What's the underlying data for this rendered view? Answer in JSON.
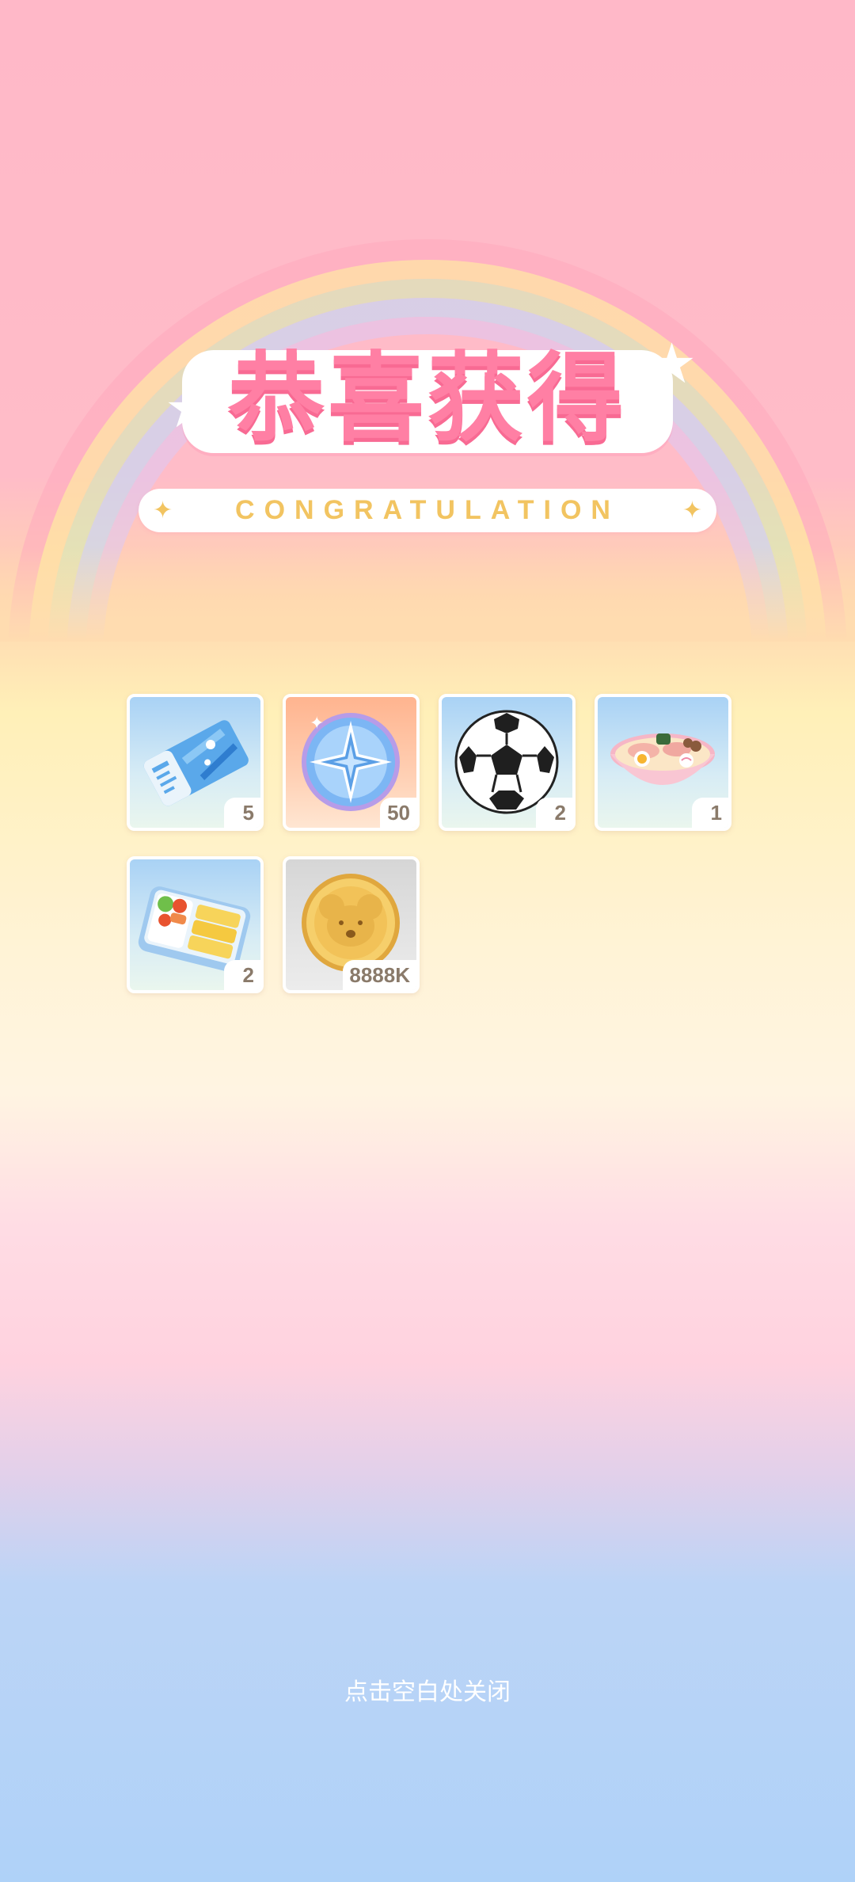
{
  "header": {
    "title": "恭喜获得",
    "subtitle": "CONGRATULATION"
  },
  "rewards": [
    {
      "name": "ticket",
      "count": "5",
      "icon": "ticket-icon"
    },
    {
      "name": "star-coin",
      "count": "50",
      "icon": "star-coin-icon"
    },
    {
      "name": "soccer-ball",
      "count": "2",
      "icon": "soccer-ball-icon"
    },
    {
      "name": "ramen",
      "count": "1",
      "icon": "ramen-icon"
    },
    {
      "name": "bento",
      "count": "2",
      "icon": "bento-icon"
    },
    {
      "name": "gold-coin",
      "count": "8888K",
      "icon": "gold-coin-icon"
    }
  ],
  "footer": {
    "close_hint": "点击空白处关闭"
  },
  "colors": {
    "title_pink": "#ff7fa4",
    "subtitle_gold": "#f2c461",
    "badge_text": "#8a7a6a"
  }
}
